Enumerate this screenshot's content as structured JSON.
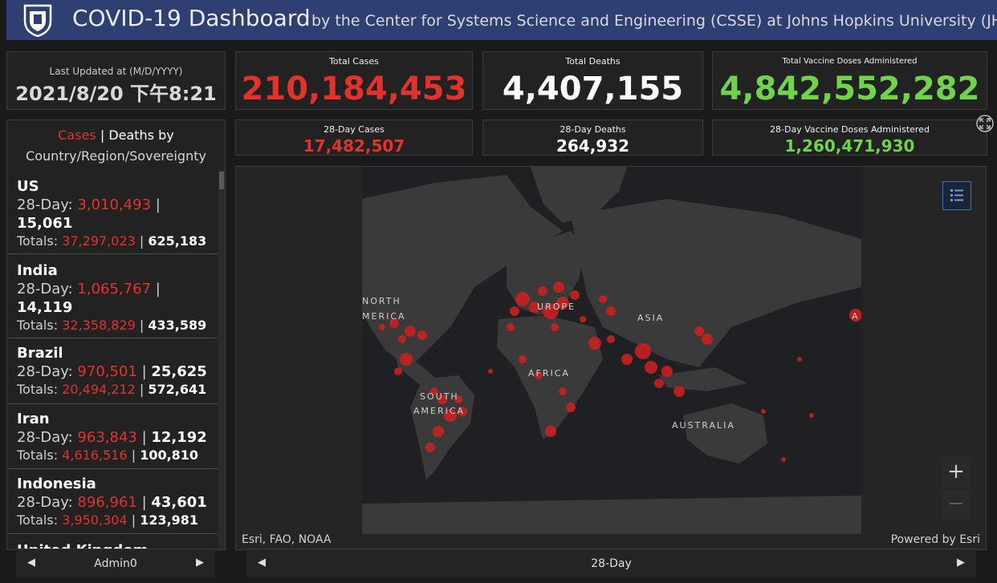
{
  "header": {
    "title": "COVID-19 Dashboard",
    "subtitle": "by the Center for Systems Science and Engineering (CSSE) at Johns Hopkins University (JHU)",
    "logo_icon": "jhu-shield-icon"
  },
  "last_updated": {
    "label": "Last Updated at (M/D/YYYY)",
    "value": "2021/8/20 下午8:21"
  },
  "totals": {
    "cases_label": "Total Cases",
    "cases_value": "210,184,453",
    "deaths_label": "Total Deaths",
    "deaths_value": "4,407,155",
    "vaccine_label": "Total Vaccine Doses Administered",
    "vaccine_value": "4,842,552,282"
  },
  "day28": {
    "cases_label": "28-Day Cases",
    "cases_value": "17,482,507",
    "deaths_label": "28-Day Deaths",
    "deaths_value": "264,932",
    "vaccine_label": "28-Day Vaccine Doses Administered",
    "vaccine_value": "1,260,471,930"
  },
  "country_list": {
    "header_cases": "Cases",
    "header_sep": " | ",
    "header_deaths": "Deaths",
    "header_rest1": " by",
    "header_rest2": "Country/Region/Sovereignty",
    "day_prefix": "28-Day: ",
    "totals_prefix": "Totals: ",
    "items": [
      {
        "country": "US",
        "d28_cases": "3,010,493",
        "d28_deaths": "15,061",
        "total_cases": "37,297,023",
        "total_deaths": "625,183"
      },
      {
        "country": "India",
        "d28_cases": "1,065,767",
        "d28_deaths": "14,119",
        "total_cases": "32,358,829",
        "total_deaths": "433,589"
      },
      {
        "country": "Brazil",
        "d28_cases": "970,501",
        "d28_deaths": "25,625",
        "total_cases": "20,494,212",
        "total_deaths": "572,641"
      },
      {
        "country": "Iran",
        "d28_cases": "963,843",
        "d28_deaths": "12,192",
        "total_cases": "4,616,516",
        "total_deaths": "100,810"
      },
      {
        "country": "Indonesia",
        "d28_cases": "896,961",
        "d28_deaths": "43,601",
        "total_cases": "3,950,304",
        "total_deaths": "123,981"
      },
      {
        "country": "United Kingdom"
      }
    ]
  },
  "left_nav": {
    "label": "Admin0"
  },
  "map": {
    "labels": {
      "north_america_1": "NORTH",
      "north_america_2": "MERICA",
      "europe": "UROPE",
      "asia": "ASIA",
      "africa": "AFRICA",
      "south_america_1": "SOUTH",
      "south_america_2": "AMERICA",
      "australia": "AUSTRALIA",
      "edge_a": "A"
    },
    "attribution": "Esri, FAO, NOAA",
    "powered_by": "Powered by Esri",
    "zoom_in": "+",
    "zoom_out": "—",
    "colors": {
      "dot": "#d0201d",
      "land": "#3a3a3a",
      "ocean": "#1e2024"
    }
  },
  "right_nav": {
    "label": "28-Day"
  }
}
